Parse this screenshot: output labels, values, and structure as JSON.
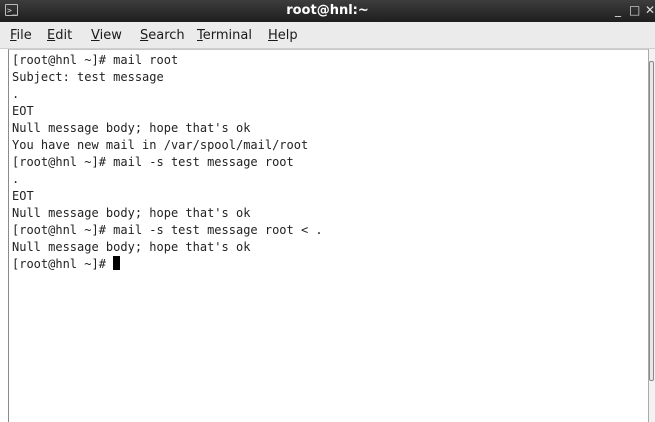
{
  "window": {
    "title": "root@hnl:~",
    "minimize_glyph": "_",
    "maximize_glyph": "□",
    "close_glyph": "✕"
  },
  "menu": {
    "file": {
      "accel": "F",
      "rest": "ile"
    },
    "edit": {
      "accel": "E",
      "rest": "dit"
    },
    "view": {
      "accel": "V",
      "rest": "iew"
    },
    "search": {
      "accel": "S",
      "rest": "earch"
    },
    "terminal": {
      "accel": "T",
      "rest": "erminal"
    },
    "help": {
      "accel": "H",
      "rest": "elp"
    }
  },
  "terminal": {
    "lines": [
      "[root@hnl ~]# mail root",
      "Subject: test message",
      ".",
      "EOT",
      "Null message body; hope that's ok",
      "You have new mail in /var/spool/mail/root",
      "[root@hnl ~]# mail -s test message root",
      ".",
      "EOT",
      "Null message body; hope that's ok",
      "[root@hnl ~]# mail -s test message root < .",
      "Null message body; hope that's ok",
      "[root@hnl ~]# "
    ]
  }
}
